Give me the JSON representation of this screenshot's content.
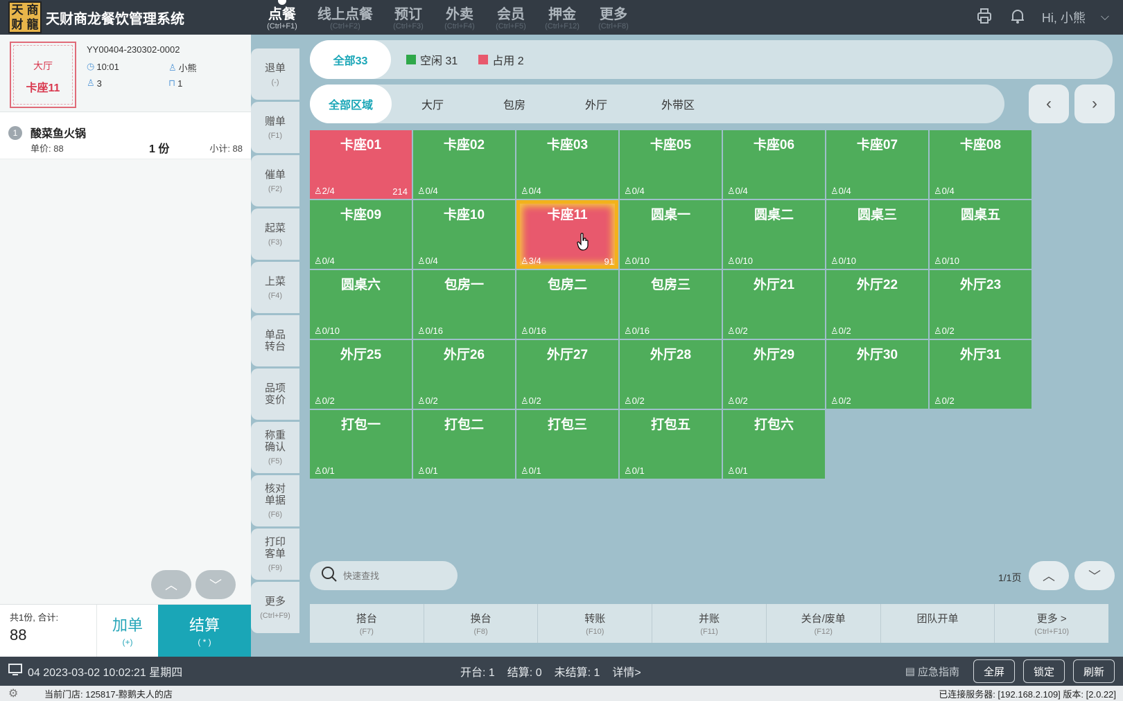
{
  "app": {
    "logo_chars": [
      "天",
      "商",
      "财",
      "龍"
    ],
    "title": "天财商龙餐饮管理系统",
    "greeting": "Hi, 小熊"
  },
  "nav": [
    {
      "label": "点餐",
      "key": "(Ctrl+F1)",
      "active": true
    },
    {
      "label": "线上点餐",
      "key": "(Ctrl+F2)",
      "active": false
    },
    {
      "label": "预订",
      "key": "(Ctrl+F3)",
      "active": false
    },
    {
      "label": "外卖",
      "key": "(Ctrl+F4)",
      "active": false
    },
    {
      "label": "会员",
      "key": "(Ctrl+F5)",
      "active": false
    },
    {
      "label": "押金",
      "key": "(Ctrl+F12)",
      "active": false
    },
    {
      "label": "更多",
      "key": "(Ctrl+F8)",
      "active": false
    }
  ],
  "order": {
    "area": "大厅",
    "table": "卡座11",
    "order_no": "YY00404-230302-0002",
    "time": "10:01",
    "waiter": "小熊",
    "guests": "3",
    "table_count": "1",
    "items": [
      {
        "index": "1",
        "name": "酸菜鱼火锅",
        "price": "单价: 88",
        "qty": "1 份",
        "subtotal": "小计: 88"
      }
    ],
    "total_label": "共1份, 合计:",
    "total_value": "88",
    "add_label": "加单",
    "add_key": "(+)",
    "settle_label": "结算",
    "settle_key": "( * )"
  },
  "actions": [
    {
      "label": "退单",
      "key": "(-)"
    },
    {
      "label": "赠单",
      "key": "(F1)"
    },
    {
      "label": "催单",
      "key": "(F2)"
    },
    {
      "label": "起菜",
      "key": "(F3)"
    },
    {
      "label": "上菜",
      "key": "(F4)"
    },
    {
      "label": "单品\n转台",
      "key": ""
    },
    {
      "label": "品项\n变价",
      "key": ""
    },
    {
      "label": "称重\n确认",
      "key": "(F5)"
    },
    {
      "label": "核对\n单据",
      "key": "(F6)"
    },
    {
      "label": "打印\n客单",
      "key": "(F9)"
    },
    {
      "label": "更多",
      "key": "(Ctrl+F9)"
    }
  ],
  "status_tabs": [
    {
      "label": "全部33",
      "active": true
    },
    {
      "label": "空闲 31",
      "color": "#2fa84a"
    },
    {
      "label": "占用 2",
      "color": "#e8596d"
    }
  ],
  "area_tabs": [
    {
      "label": "全部区域",
      "active": true
    },
    {
      "label": "大厅"
    },
    {
      "label": "包房"
    },
    {
      "label": "外厅"
    },
    {
      "label": "外带区"
    }
  ],
  "colors": {
    "free": "#4fad5b",
    "busy": "#e8596d",
    "accent": "#1aa6b7"
  },
  "tables": [
    {
      "name": "卡座01",
      "seats": "2/4",
      "amount": "214",
      "state": "busy"
    },
    {
      "name": "卡座02",
      "seats": "0/4",
      "amount": "",
      "state": "free"
    },
    {
      "name": "卡座03",
      "seats": "0/4",
      "amount": "",
      "state": "free"
    },
    {
      "name": "卡座05",
      "seats": "0/4",
      "amount": "",
      "state": "free"
    },
    {
      "name": "卡座06",
      "seats": "0/4",
      "amount": "",
      "state": "free"
    },
    {
      "name": "卡座07",
      "seats": "0/4",
      "amount": "",
      "state": "free"
    },
    {
      "name": "卡座08",
      "seats": "0/4",
      "amount": "",
      "state": "free"
    },
    {
      "name": "卡座09",
      "seats": "0/4",
      "amount": "",
      "state": "free"
    },
    {
      "name": "卡座10",
      "seats": "0/4",
      "amount": "",
      "state": "free"
    },
    {
      "name": "卡座11",
      "seats": "3/4",
      "amount": "91",
      "state": "selected"
    },
    {
      "name": "圆桌一",
      "seats": "0/10",
      "amount": "",
      "state": "free"
    },
    {
      "name": "圆桌二",
      "seats": "0/10",
      "amount": "",
      "state": "free"
    },
    {
      "name": "圆桌三",
      "seats": "0/10",
      "amount": "",
      "state": "free"
    },
    {
      "name": "圆桌五",
      "seats": "0/10",
      "amount": "",
      "state": "free"
    },
    {
      "name": "圆桌六",
      "seats": "0/10",
      "amount": "",
      "state": "free"
    },
    {
      "name": "包房一",
      "seats": "0/16",
      "amount": "",
      "state": "free"
    },
    {
      "name": "包房二",
      "seats": "0/16",
      "amount": "",
      "state": "free"
    },
    {
      "name": "包房三",
      "seats": "0/16",
      "amount": "",
      "state": "free"
    },
    {
      "name": "外厅21",
      "seats": "0/2",
      "amount": "",
      "state": "free"
    },
    {
      "name": "外厅22",
      "seats": "0/2",
      "amount": "",
      "state": "free"
    },
    {
      "name": "外厅23",
      "seats": "0/2",
      "amount": "",
      "state": "free"
    },
    {
      "name": "外厅25",
      "seats": "0/2",
      "amount": "",
      "state": "free"
    },
    {
      "name": "外厅26",
      "seats": "0/2",
      "amount": "",
      "state": "free"
    },
    {
      "name": "外厅27",
      "seats": "0/2",
      "amount": "",
      "state": "free"
    },
    {
      "name": "外厅28",
      "seats": "0/2",
      "amount": "",
      "state": "free"
    },
    {
      "name": "外厅29",
      "seats": "0/2",
      "amount": "",
      "state": "free"
    },
    {
      "name": "外厅30",
      "seats": "0/2",
      "amount": "",
      "state": "free"
    },
    {
      "name": "外厅31",
      "seats": "0/2",
      "amount": "",
      "state": "free"
    },
    {
      "name": "打包一",
      "seats": "0/1",
      "amount": "",
      "state": "free"
    },
    {
      "name": "打包二",
      "seats": "0/1",
      "amount": "",
      "state": "free"
    },
    {
      "name": "打包三",
      "seats": "0/1",
      "amount": "",
      "state": "free"
    },
    {
      "name": "打包五",
      "seats": "0/1",
      "amount": "",
      "state": "free"
    },
    {
      "name": "打包六",
      "seats": "0/1",
      "amount": "",
      "state": "free"
    }
  ],
  "search": {
    "placeholder": "快速查找"
  },
  "pager": {
    "text": "1/1页"
  },
  "functions": [
    {
      "label": "搭台",
      "key": "(F7)"
    },
    {
      "label": "换台",
      "key": "(F8)"
    },
    {
      "label": "转账",
      "key": "(F10)"
    },
    {
      "label": "并账",
      "key": "(F11)"
    },
    {
      "label": "关台/废单",
      "key": "(F12)"
    },
    {
      "label": "团队开单",
      "key": ""
    },
    {
      "label": "更多 >",
      "key": "(Ctrl+F10)"
    }
  ],
  "statusbar": {
    "datetime": "04 2023-03-02 10:02:21 星期四",
    "open": "开台: 1",
    "settled": "结算: 0",
    "unsettled": "未结算: 1",
    "details": "详情>",
    "guide": "应急指南",
    "fullscreen": "全屏",
    "lock": "锁定",
    "refresh": "刷新"
  },
  "footer": {
    "store": "当前门店: 125817-黥鹅夫人的店",
    "server": "已连接服务器: [192.168.2.109] 版本: [2.0.22]"
  }
}
